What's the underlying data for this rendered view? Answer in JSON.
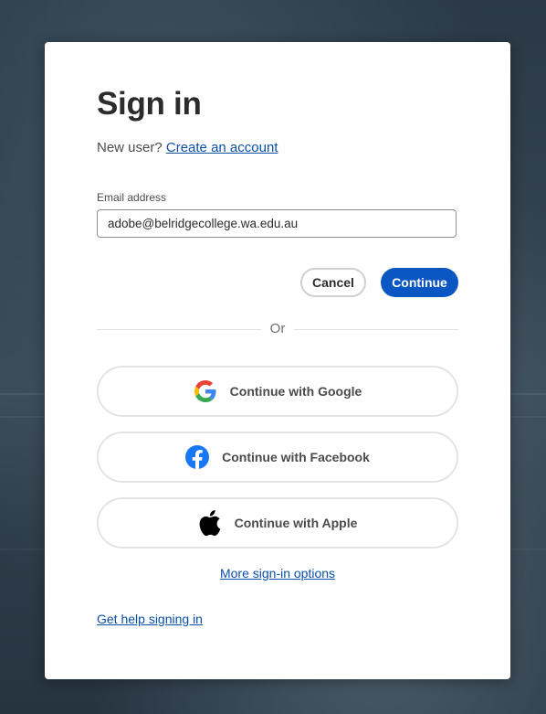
{
  "signin": {
    "title": "Sign in",
    "new_user_prefix": "New user?",
    "create_account_link": "Create an account",
    "email_label": "Email address",
    "email_value": "adobe@belridgecollege.wa.edu.au",
    "cancel_label": "Cancel",
    "continue_label": "Continue",
    "divider_text": "Or",
    "social": {
      "google_label": "Continue with Google",
      "facebook_label": "Continue with Facebook",
      "apple_label": "Continue with Apple"
    },
    "more_options_link": "More sign-in options",
    "help_link": "Get help signing in"
  },
  "colors": {
    "primary_button": "#0a56c2",
    "link": "#0d66d0",
    "facebook": "#1877f2"
  },
  "icons": {
    "google": "google-icon",
    "facebook": "facebook-icon",
    "apple": "apple-icon"
  }
}
